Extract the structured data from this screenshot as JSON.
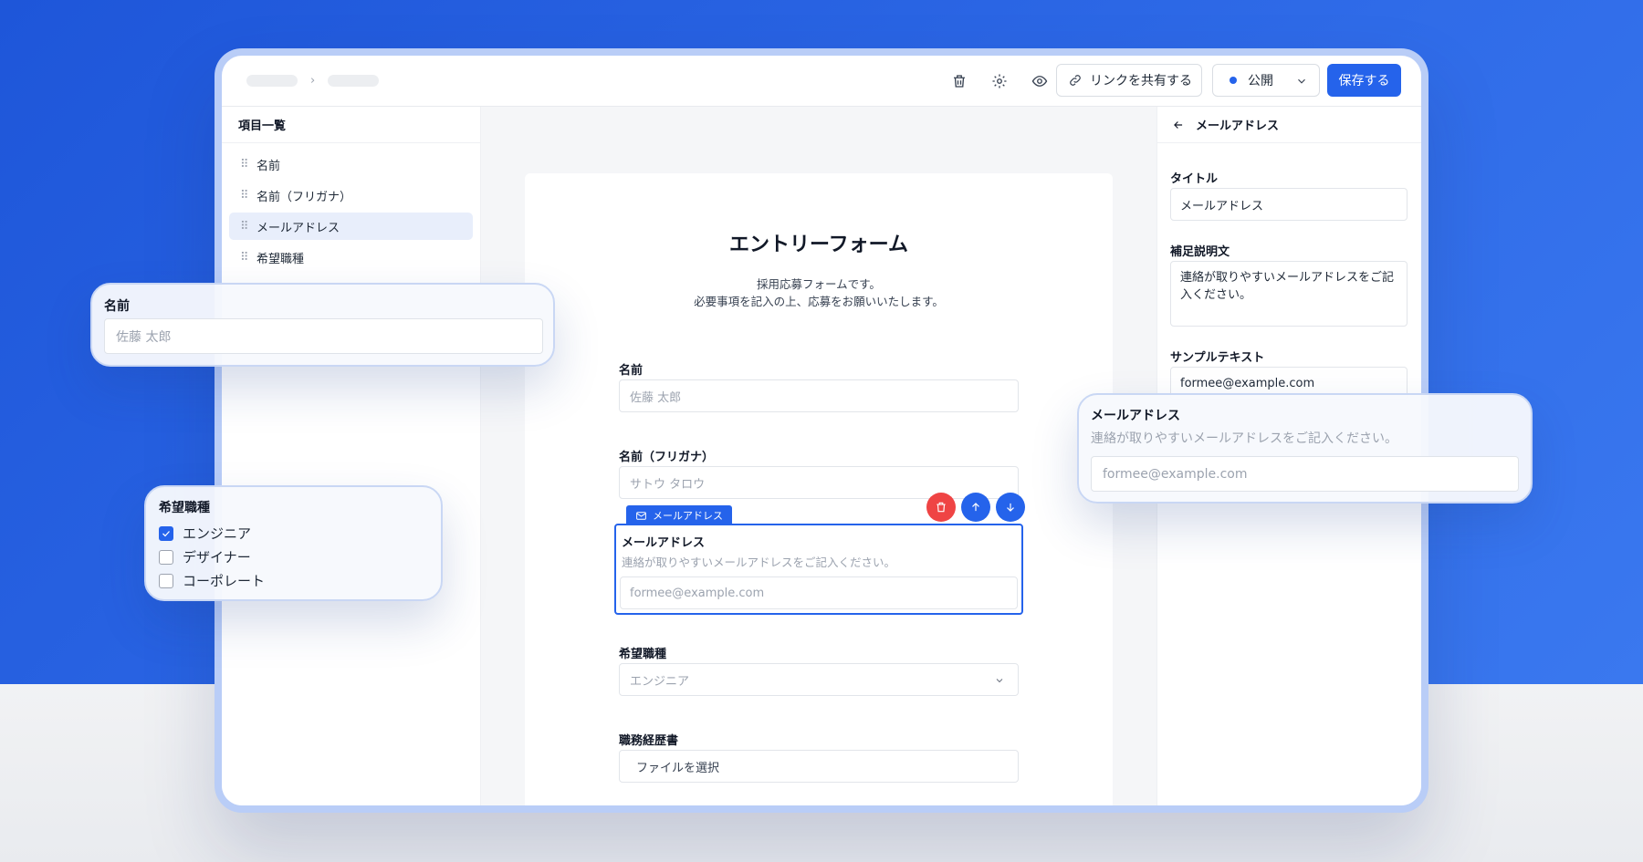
{
  "colors": {
    "accent": "#2563eb",
    "danger": "#ef4444",
    "background": "#2f6be8"
  },
  "toolbar": {
    "share_label": "リンクを共有する",
    "status_value": "公開",
    "save_label": "保存する",
    "icons": [
      "trash-icon",
      "gear-icon",
      "eye-icon",
      "link-icon"
    ]
  },
  "sidebar": {
    "title": "項目一覧",
    "items": [
      {
        "label": "名前"
      },
      {
        "label": "名前（フリガナ）"
      },
      {
        "label": "メールアドレス",
        "active": true
      },
      {
        "label": "希望職種"
      }
    ]
  },
  "form": {
    "title": "エントリーフォーム",
    "description_line1": "採用応募フォームです。",
    "description_line2": "必要事項を記入の上、応募をお願いいたします。",
    "fields": {
      "name": {
        "label": "名前",
        "placeholder": "佐藤 太郎"
      },
      "kana": {
        "label": "名前（フリガナ）",
        "placeholder": "サトウ タロウ"
      },
      "email": {
        "tag": "メールアドレス",
        "label": "メールアドレス",
        "help": "連絡が取りやすいメールアドレスをご記入ください。",
        "placeholder": "formee@example.com"
      },
      "job": {
        "label": "希望職種",
        "value": "エンジニア"
      },
      "resume": {
        "label": "職務経歴書",
        "button": "ファイルを選択"
      }
    }
  },
  "settings": {
    "title": "メールアドレス",
    "title_label": "タイトル",
    "title_value": "メールアドレス",
    "desc_label": "補足説明文",
    "desc_value": "連絡が取りやすいメールアドレスをご記入ください。",
    "sample_label": "サンプルテキスト",
    "sample_value": "formee@example.com"
  },
  "float_name": {
    "label": "名前",
    "placeholder": "佐藤 太郎"
  },
  "float_job": {
    "label": "希望職種",
    "options": [
      {
        "label": "エンジニア",
        "checked": true
      },
      {
        "label": "デザイナー",
        "checked": false
      },
      {
        "label": "コーポレート",
        "checked": false
      }
    ]
  },
  "float_email": {
    "label": "メールアドレス",
    "help": "連絡が取りやすいメールアドレスをご記入ください。",
    "placeholder": "formee@example.com"
  }
}
